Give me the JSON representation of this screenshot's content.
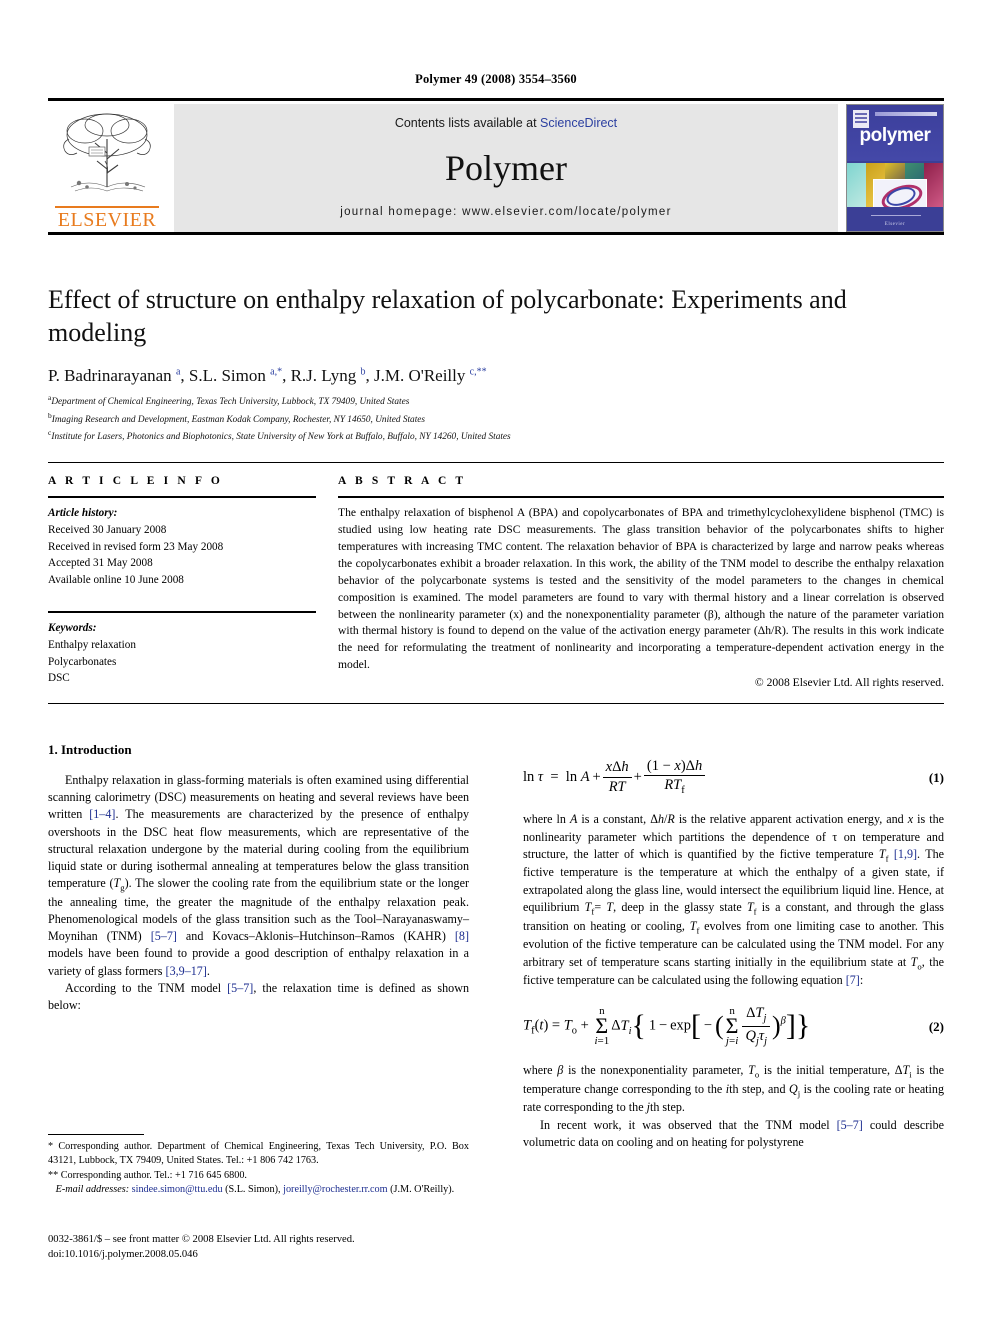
{
  "running_head": "Polymer 49 (2008) 3554–3560",
  "masthead": {
    "contents_prefix": "Contents lists available at ",
    "sciencedirect": "ScienceDirect",
    "journal_name": "Polymer",
    "homepage": "journal homepage: www.elsevier.com/locate/polymer",
    "publisher": "ELSEVIER",
    "cover_title": "polymer",
    "cover_footer": "Elsevier",
    "link_color": "#2b3fa0",
    "elsevier_orange": "#E87B1E",
    "band_gray": "#e6e6e6"
  },
  "article": {
    "title": "Effect of structure on enthalpy relaxation of polycarbonate: Experiments and modeling",
    "authors_html": "P. Badrinarayanan <sup>a</sup>, S.L. Simon <sup>a,*</sup>, R.J. Lyng <sup>b</sup>, J.M. O'Reilly <sup>c,**</sup>",
    "affiliations": [
      {
        "marker": "a",
        "text": "Department of Chemical Engineering, Texas Tech University, Lubbock, TX 79409, United States"
      },
      {
        "marker": "b",
        "text": "Imaging Research and Development, Eastman Kodak Company, Rochester, NY 14650, United States"
      },
      {
        "marker": "c",
        "text": "Institute for Lasers, Photonics and Biophotonics, State University of New York at Buffalo, Buffalo, NY 14260, United States"
      }
    ]
  },
  "article_info": {
    "heading": "A R T I C L E  I N F O",
    "history_label": "Article history:",
    "history": [
      "Received 30 January 2008",
      "Received in revised form 23 May 2008",
      "Accepted 31 May 2008",
      "Available online 10 June 2008"
    ],
    "keywords_label": "Keywords:",
    "keywords": [
      "Enthalpy relaxation",
      "Polycarbonates",
      "DSC"
    ]
  },
  "abstract": {
    "heading": "A B S T R A C T",
    "text": "The enthalpy relaxation of bisphenol A (BPA) and copolycarbonates of BPA and trimethylcyclohexylidene bisphenol (TMC) is studied using low heating rate DSC measurements. The glass transition behavior of the polycarbonates shifts to higher temperatures with increasing TMC content. The relaxation behavior of BPA is characterized by large and narrow peaks whereas the copolycarbonates exhibit a broader relaxation. In this work, the ability of the TNM model to describe the enthalpy relaxation behavior of the polycarbonate systems is tested and the sensitivity of the model parameters to the changes in chemical composition is examined. The model parameters are found to vary with thermal history and a linear correlation is observed between the nonlinearity parameter (x) and the nonexponentiality parameter (β), although the nature of the parameter variation with thermal history is found to depend on the value of the activation energy parameter (Δh/R). The results in this work indicate the need for reformulating the treatment of nonlinearity and incorporating a temperature-dependent activation energy in the model.",
    "copyright": "© 2008 Elsevier Ltd. All rights reserved."
  },
  "introduction": {
    "heading": "1. Introduction",
    "para1_html": "Enthalpy relaxation in glass-forming materials is often examined using differential scanning calorimetry (DSC) measurements on heating and several reviews have been written <span class=\"ref\">[1–4]</span>. The measurements are characterized by the presence of enthalpy overshoots in the DSC heat flow measurements, which are representative of the structural relaxation undergone by the material during cooling from the equilibrium liquid state or during isothermal annealing at temperatures below the glass transition temperature (<i>T</i><sub>g</sub>). The slower the cooling rate from the equilibrium state or the longer the annealing time, the greater the magnitude of the enthalpy relaxation peak. Phenomenological models of the glass transition such as the Tool–Narayanaswamy–Moynihan (TNM) <span class=\"ref\">[5–7]</span> and Kovacs–Aklonis–Hutchinson–Ramos (KAHR) <span class=\"ref\">[8]</span> models have been found to provide a good description of enthalpy relaxation in a variety of glass formers <span class=\"ref\">[3,9–17]</span>.",
    "para2_html": "According to the TNM model <span class=\"ref\">[5–7]</span>, the relaxation time is defined as shown below:",
    "para3_html": "where ln <i>A</i> is a constant, Δ<i>h</i>/<i>R</i> is the relative apparent activation energy, and <i>x</i> is the nonlinearity parameter which partitions the dependence of τ on temperature and structure, the latter of which is quantified by the fictive temperature <i>T</i><sub>f</sub> <span class=\"ref\">[1,9]</span>. The fictive temperature is the temperature at which the enthalpy of a given state, if extrapolated along the glass line, would intersect the equilibrium liquid line. Hence, at equilibrium <i>T</i><sub>f</sub>= <i>T</i>, deep in the glassy state <i>T</i><sub>f</sub> is a constant, and through the glass transition on heating or cooling, <i>T</i><sub>f</sub> evolves from one limiting case to another. This evolution of the fictive temperature can be calculated using the TNM model. For any arbitrary set of temperature scans starting initially in the equilibrium state at <i>T</i><sub>o</sub>, the fictive temperature can be calculated using the following equation <span class=\"ref\">[7]</span>:",
    "para4_html": "where <i>β</i> is the nonexponentiality parameter, <i>T</i><sub>o</sub> is the initial temperature, Δ<i>T</i><sub>i</sub> is the temperature change corresponding to the <i>i</i>th step, and <i>Q</i><sub>j</sub> is the cooling rate or heating rate corresponding to the <i>j</i>th step.",
    "para5_html": "In recent work, it was observed that the TNM model <span class=\"ref\">[5–7]</span> could describe volumetric data on cooling and on heating for polystyrene"
  },
  "equations": [
    {
      "number": "(1)",
      "plain": "ln τ = ln A + xΔh/RT + (1 − x)Δh/RT_f"
    },
    {
      "number": "(2)",
      "plain": "T_f(t) = T_o + Σ(i=1..n) ΔT_i { 1 − exp[ −( Σ(j=i..n) ΔT_j/(Q_j τ_j) )^β ] }"
    }
  ],
  "footnotes": {
    "corresponding1": "* Corresponding author. Department of Chemical Engineering, Texas Tech University, P.O. Box 43121, Lubbock, TX 79409, United States. Tel.: +1 806 742 1763.",
    "corresponding2": "** Corresponding author. Tel.: +1 716 645 6800.",
    "email_label": "E-mail addresses:",
    "email1": "sindee.simon@ttu.edu",
    "email1_owner": "(S.L. Simon),",
    "email2": "joreilly@rochester.rr.com",
    "email2_owner": "(J.M. O'Reilly)."
  },
  "footer": {
    "issn_line": "0032-3861/$ – see front matter © 2008 Elsevier Ltd. All rights reserved.",
    "doi_line": "doi:10.1016/j.polymer.2008.05.046"
  }
}
